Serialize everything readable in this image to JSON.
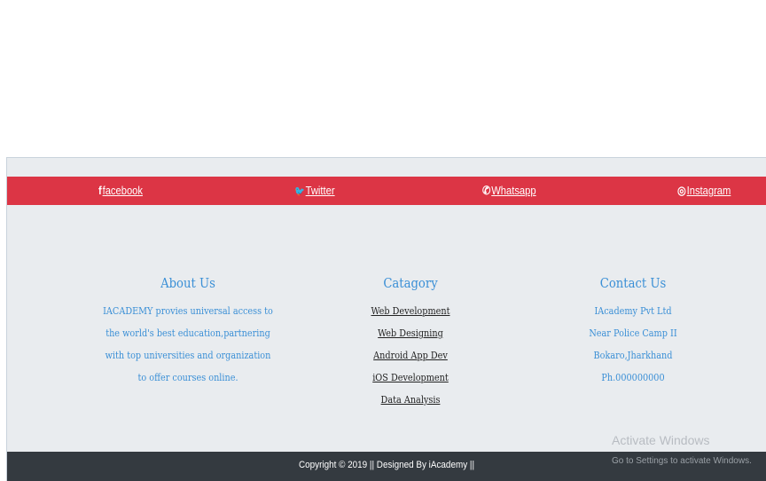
{
  "social": {
    "facebook": {
      "icon": "facebook-icon",
      "glyph": "f",
      "label": "facebook"
    },
    "twitter": {
      "icon": "twitter-icon",
      "glyph": "🐦",
      "label": "Twitter"
    },
    "whatsapp": {
      "icon": "whatsapp-icon",
      "glyph": "✆",
      "label": "Whatsapp"
    },
    "instagram": {
      "icon": "instagram-icon",
      "glyph": "◎",
      "label": "Instagram"
    }
  },
  "about": {
    "title": "About Us",
    "lines": [
      "IACADEMY provies universal access to",
      "the world's best education,partnering",
      "with top universities and organization",
      "to offer courses online."
    ]
  },
  "category": {
    "title": "Catagory",
    "links": [
      "Web Development",
      "Web Designing",
      "Android App Dev",
      "iOS Development",
      "Data Analysis"
    ]
  },
  "contact": {
    "title": "Contact Us",
    "lines": [
      "IAcademy Pvt Ltd",
      "Near Police Camp II",
      "Bokaro,Jharkhand",
      "Ph.000000000"
    ]
  },
  "footer": {
    "copyright": "Copyright © 2019 || Designed By iAcademy ||"
  },
  "watermark": {
    "title": "Activate Windows",
    "subtitle": "Go to Settings to activate Windows."
  },
  "colors": {
    "bar": "#dc3545",
    "footer": "#343a40",
    "accent": "#3a8fd6",
    "panel": "#e9ecef"
  }
}
